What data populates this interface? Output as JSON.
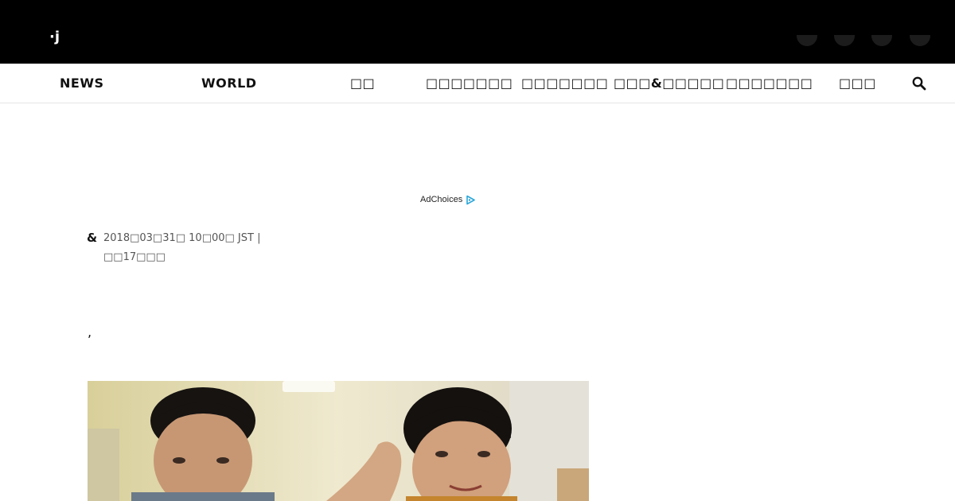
{
  "header": {
    "logo_fragment": "·j"
  },
  "nav": {
    "items": [
      {
        "label": "NEWS"
      },
      {
        "label": "WORLD"
      },
      {
        "label": "□□"
      },
      {
        "label": "□□□□□□□"
      },
      {
        "label": "□□□□□□□"
      },
      {
        "label": "□□□&□□□□□"
      },
      {
        "label": "□□□□□□□"
      },
      {
        "label": "□□□"
      }
    ]
  },
  "ad": {
    "label": "AdChoices"
  },
  "article": {
    "byline_symbol": "&",
    "date": "2018□03□31□ 10□00□ JST |",
    "subline": "□□17□□□",
    "comma": ","
  },
  "colors": {
    "topbar": "#000000",
    "adchoices_icon": "#2aa7d9"
  }
}
